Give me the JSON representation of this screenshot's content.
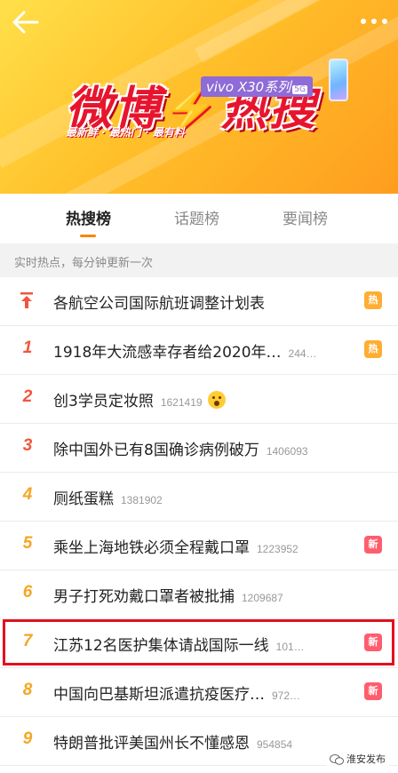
{
  "banner": {
    "logo_text_1": "微博",
    "logo_text_2": "热",
    "logo_text_3": "搜",
    "sponsor": "vivo X30系列",
    "sponsor_badge": "5G",
    "slogan": "最新鲜 · 最热门 · 最有料",
    "back_icon": "back-arrow-icon",
    "more_icon": "more-dots-icon"
  },
  "tabs": [
    {
      "label": "热搜榜",
      "active": true
    },
    {
      "label": "话题榜",
      "active": false
    },
    {
      "label": "要闻榜",
      "active": false
    }
  ],
  "subtitle": "实时热点，每分钟更新一次",
  "items": [
    {
      "rank": "",
      "pinned": true,
      "title": "各航空公司国际航班调整计划表",
      "count": "",
      "tag": "热"
    },
    {
      "rank": "1",
      "title": "1918年大流感幸存者给2020年…",
      "count": "244…",
      "tag": "热"
    },
    {
      "rank": "2",
      "title": "创3学员定妆照",
      "count": "1621419",
      "emoji": "scream-face-icon",
      "tag": ""
    },
    {
      "rank": "3",
      "title": "除中国外已有8国确诊病例破万",
      "count": "1406093",
      "tag": ""
    },
    {
      "rank": "4",
      "title": "厕纸蛋糕",
      "count": "1381902",
      "tag": ""
    },
    {
      "rank": "5",
      "title": "乘坐上海地铁必须全程戴口罩",
      "count": "1223952",
      "tag": "新"
    },
    {
      "rank": "6",
      "title": "男子打死劝戴口罩者被批捕",
      "count": "1209687",
      "tag": ""
    },
    {
      "rank": "7",
      "title": "江苏12名医护集体请战国际一线",
      "count": "101…",
      "tag": "新"
    },
    {
      "rank": "8",
      "title": "中国向巴基斯坦派遣抗疫医疗…",
      "count": "972…",
      "tag": "新"
    },
    {
      "rank": "9",
      "title": "特朗普批评美国州长不懂感恩",
      "count": "954854",
      "tag": ""
    }
  ],
  "watermark": "淮安发布",
  "colors": {
    "accent": "#ff8200",
    "top_rank": "#f0563c",
    "rank": "#f5a623",
    "hot_tag": "#ffad33",
    "new_tag": "#ff5d6e",
    "highlight": "#e4101e"
  }
}
